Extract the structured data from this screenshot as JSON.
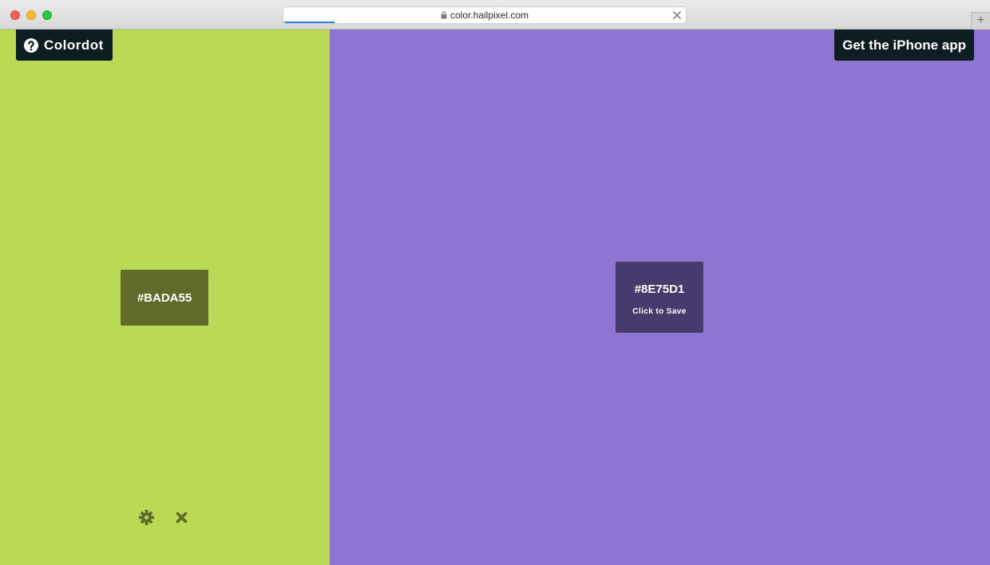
{
  "browser": {
    "url": "color.hailpixel.com",
    "new_tab_symbol": "+"
  },
  "header": {
    "brand_label": "Colordot",
    "app_button_label": "Get the iPhone app"
  },
  "colors": {
    "left_panel": "#BADA55",
    "left_swatch_bg": "#5E6B2A",
    "right_panel": "#8E75D1",
    "right_swatch_bg": "#463B6C",
    "dark_button_bg": "#0D1D22",
    "tool_icon": "#5E6B2A"
  },
  "swatches": [
    {
      "hex": "#BADA55"
    },
    {
      "hex": "#8E75D1",
      "action_label": "Click to Save"
    }
  ],
  "tools": {
    "settings_icon": "gear-icon",
    "close_icon": "close-icon"
  }
}
